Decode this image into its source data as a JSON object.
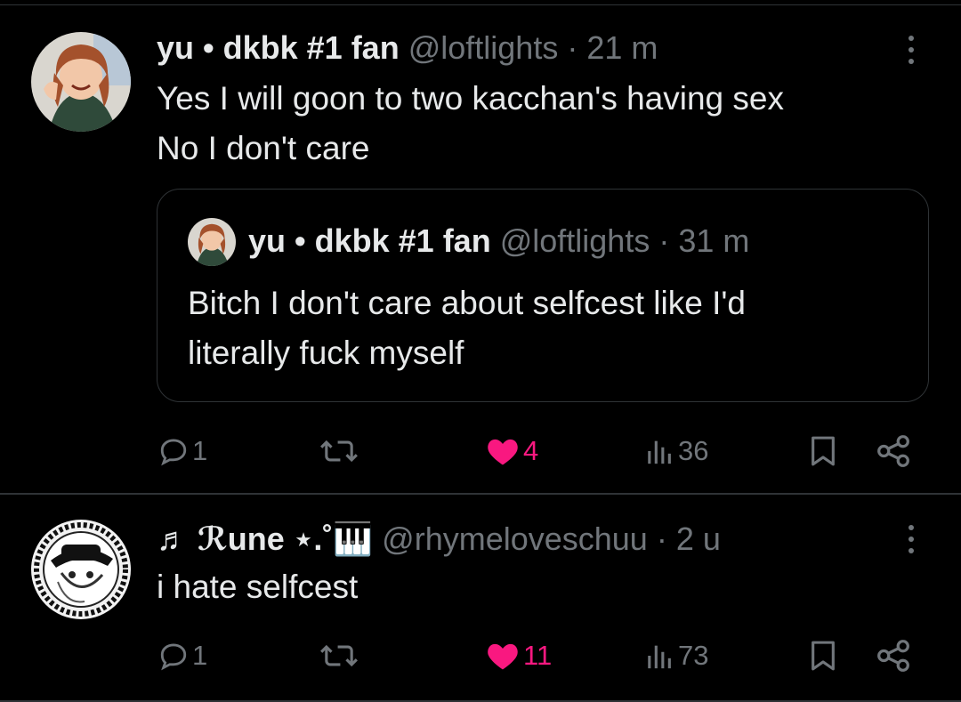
{
  "posts": [
    {
      "author_name": "yu • dkbk #1 fan",
      "handle": "@loftlights",
      "separator": "·",
      "time": "21 m",
      "text_lines": [
        "Yes I will goon to two kacchan's having sex",
        "No I don't care"
      ],
      "quote": {
        "author_name": "yu • dkbk #1 fan",
        "handle": "@loftlights",
        "separator": "·",
        "time": "31 m",
        "text_lines": [
          "Bitch I don't care about selfcest like I'd",
          "literally fuck myself"
        ]
      },
      "replies": "1",
      "reposts": "",
      "likes": "4",
      "views": "36",
      "liked": true
    },
    {
      "author_name": "♬ ℛune ⋆.˚🎹",
      "handle": "@rhymeloveschuu",
      "separator": "·",
      "time": "2 u",
      "text_lines": [
        "i hate selfcest"
      ],
      "replies": "1",
      "reposts": "",
      "likes": "11",
      "views": "73",
      "liked": true
    }
  ],
  "icons": {
    "reply": "speech-bubble-icon",
    "repost": "repost-arrows-icon",
    "like": "heart-icon",
    "views": "bar-chart-icon",
    "bookmark": "bookmark-icon",
    "share": "share-icon",
    "more": "vertical-dots-icon"
  },
  "colors": {
    "background": "#000000",
    "text": "#e7e9ea",
    "secondary": "#71767b",
    "like": "#f91880",
    "border": "#2f3336"
  }
}
